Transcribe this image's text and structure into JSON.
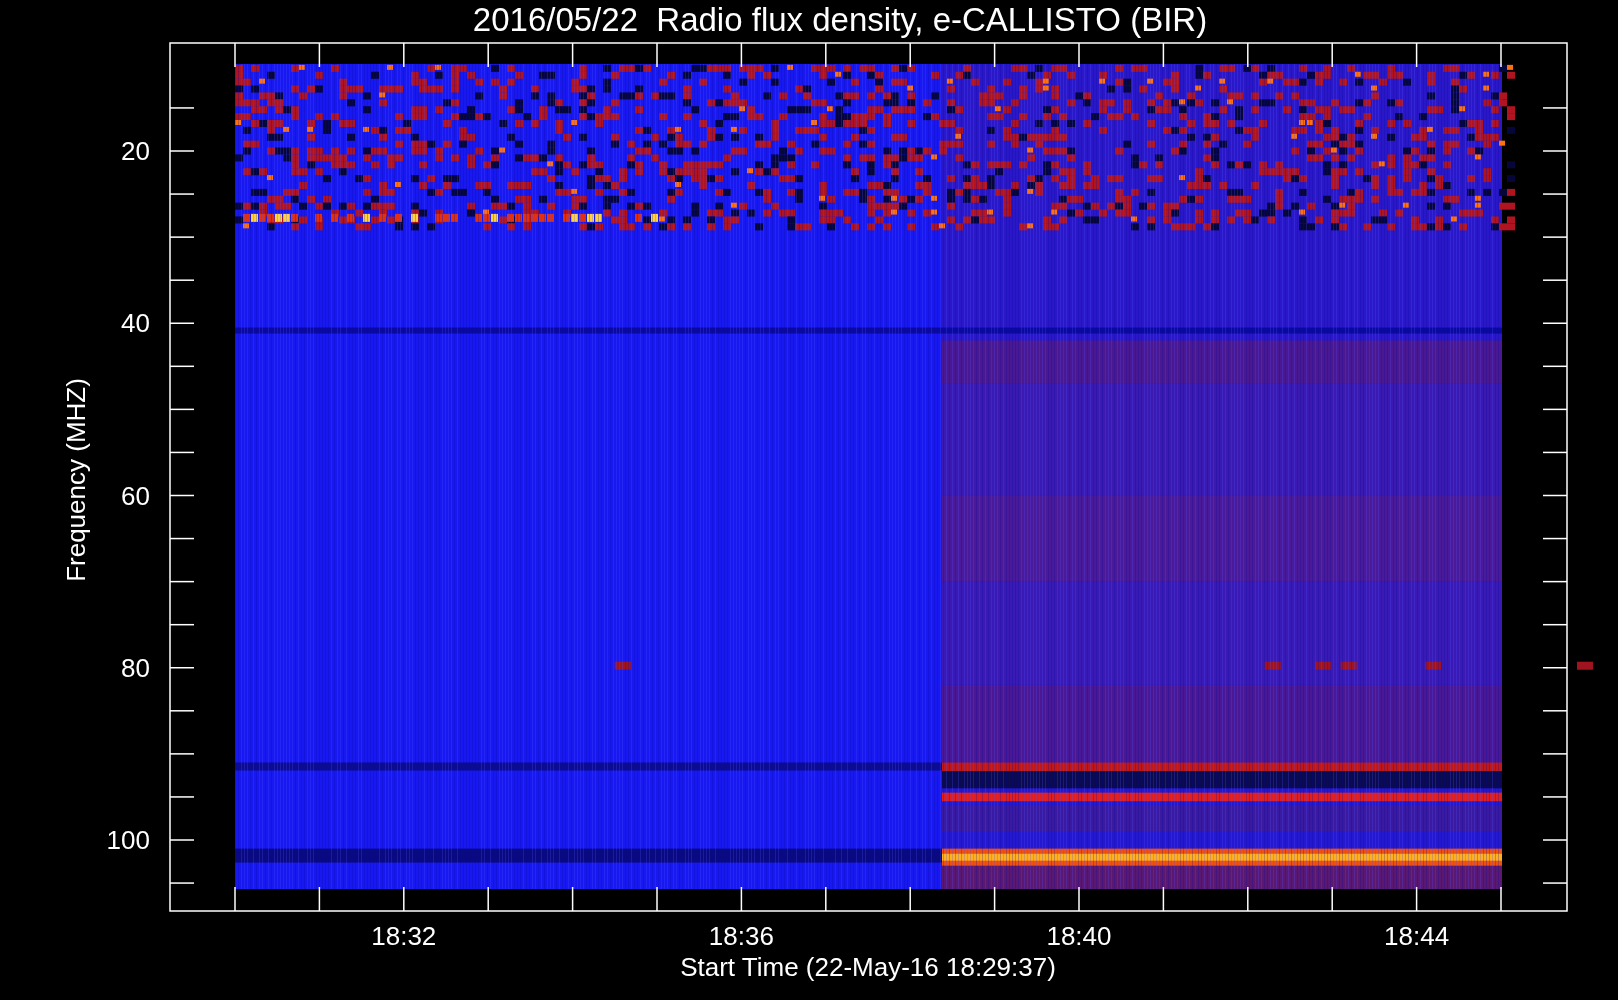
{
  "title": "2016/05/22  Radio flux density, e-CALLISTO (BIR)",
  "y_axis": {
    "label": "Frequency (MHZ)",
    "ticks": [
      "20",
      "40",
      "60",
      "80",
      "100"
    ]
  },
  "x_axis": {
    "label": "Start Time (22-May-16 18:29:37)",
    "ticks": [
      "18:32",
      "18:36",
      "18:40",
      "18:44"
    ]
  }
}
